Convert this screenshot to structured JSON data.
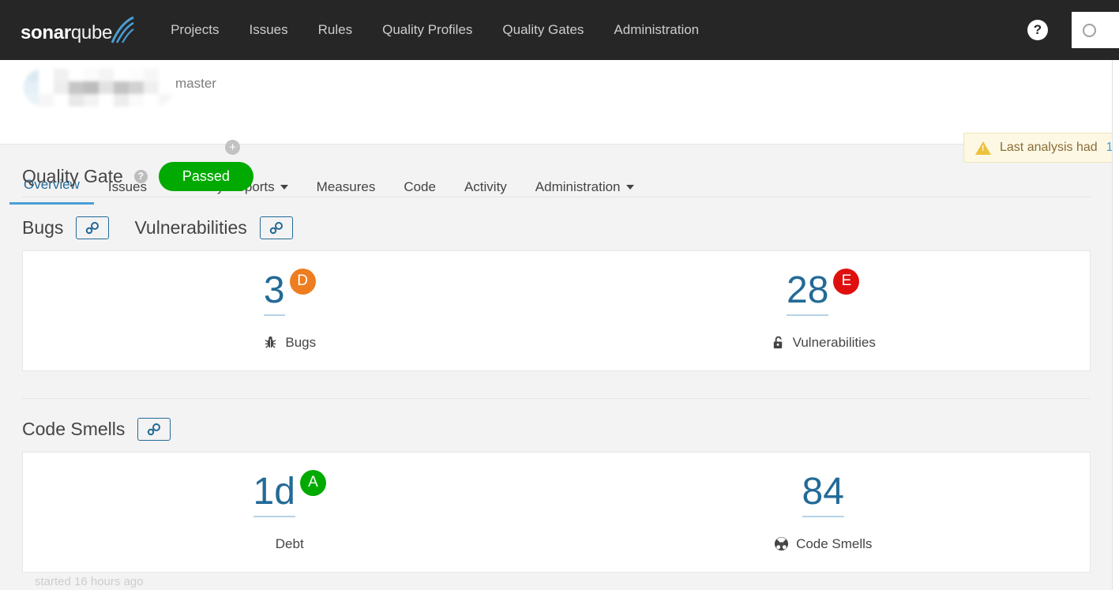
{
  "topbar": {
    "logo": {
      "bold": "sonar",
      "light": "qube"
    },
    "nav": [
      {
        "label": "Projects",
        "name": "nav-projects"
      },
      {
        "label": "Issues",
        "name": "nav-issues"
      },
      {
        "label": "Rules",
        "name": "nav-rules"
      },
      {
        "label": "Quality Profiles",
        "name": "nav-quality-profiles"
      },
      {
        "label": "Quality Gates",
        "name": "nav-quality-gates"
      },
      {
        "label": "Administration",
        "name": "nav-administration"
      }
    ],
    "help_glyph": "?",
    "search_placeholder": ""
  },
  "project": {
    "name_redacted": "",
    "branch": "master",
    "branch_plus_glyph": "+",
    "warning": {
      "text": "Last analysis had",
      "link": "1"
    }
  },
  "tabs": [
    {
      "label": "Overview",
      "name": "tab-overview",
      "active": true,
      "caret": false
    },
    {
      "label": "Issues",
      "name": "tab-issues",
      "active": false,
      "caret": false
    },
    {
      "label": "Security Reports",
      "name": "tab-security-reports",
      "active": false,
      "caret": true
    },
    {
      "label": "Measures",
      "name": "tab-measures",
      "active": false,
      "caret": false
    },
    {
      "label": "Code",
      "name": "tab-code",
      "active": false,
      "caret": false
    },
    {
      "label": "Activity",
      "name": "tab-activity",
      "active": false,
      "caret": false
    },
    {
      "label": "Administration",
      "name": "tab-project-administration",
      "active": false,
      "caret": true
    }
  ],
  "quality_gate": {
    "title": "Quality Gate",
    "help_glyph": "?",
    "status": "Passed",
    "status_color": "#00aa00"
  },
  "sections": [
    {
      "name": "bugs-vulnerabilities",
      "headings": [
        {
          "label": "Bugs",
          "icon": "link-icon"
        },
        {
          "label": "Vulnerabilities",
          "icon": "link-icon"
        }
      ],
      "metrics": [
        {
          "value": "3",
          "label": "Bugs",
          "icon": "bug-icon",
          "rating": "D",
          "rating_color": "#ed7d20"
        },
        {
          "value": "28",
          "label": "Vulnerabilities",
          "icon": "open-lock-icon",
          "rating": "E",
          "rating_color": "#e00f0f"
        }
      ]
    },
    {
      "name": "code-smells",
      "headings": [
        {
          "label": "Code Smells",
          "icon": "link-icon"
        }
      ],
      "metrics": [
        {
          "value": "1d",
          "label": "Debt",
          "icon": "none",
          "rating": "A",
          "rating_color": "#00aa00"
        },
        {
          "value": "84",
          "label": "Code Smells",
          "icon": "code-smell-icon",
          "rating": "",
          "rating_color": ""
        }
      ]
    }
  ],
  "footer": {
    "started": "started 16 hours ago"
  }
}
